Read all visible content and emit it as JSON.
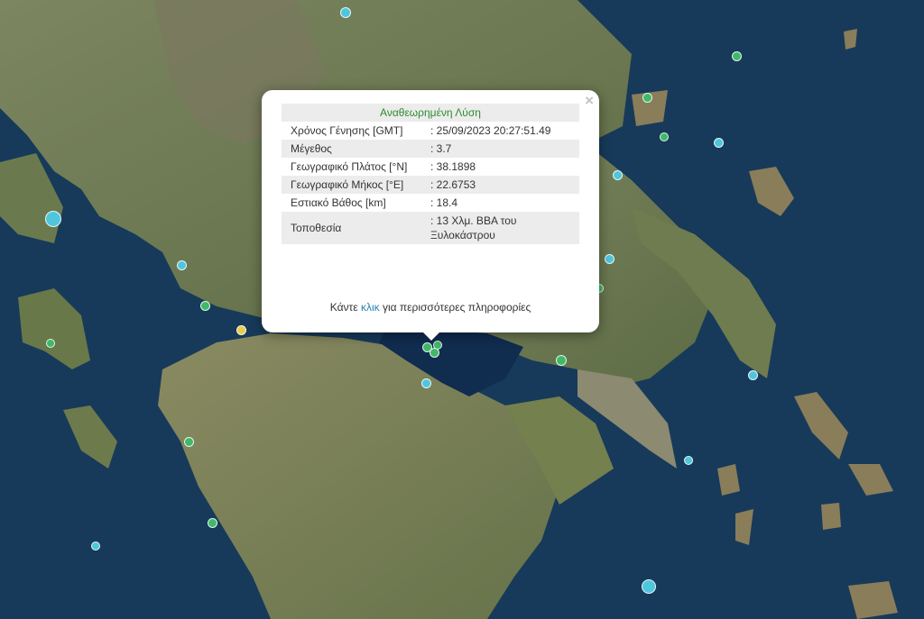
{
  "popup": {
    "header": "Αναθεωρημένη Λύση",
    "rows": [
      {
        "label": "Χρόνος Γένησης [GMT]",
        "value": ": 25/09/2023 20:27:51.49"
      },
      {
        "label": "Μέγεθος",
        "value": ": 3.7"
      },
      {
        "label": "Γεωγραφικό Πλάτος [°N]",
        "value": ": 38.1898"
      },
      {
        "label": "Γεωγραφικό Μήκος [°E]",
        "value": ": 22.6753"
      },
      {
        "label": "Εστιακό Βάθος [km]",
        "value": ": 18.4"
      },
      {
        "label": "Τοποθεσία",
        "value": ": 13 Χλμ. ΒΒΑ του Ξυλοκάστρου"
      }
    ],
    "more_prefix": "Κάντε ",
    "more_link": "κλικ",
    "more_suffix": " για περισσότερες πληροφορίες",
    "close": "×"
  },
  "colors": {
    "sea": "#173a5a",
    "land": "#6b7a4e",
    "marker_cyan": "#4fc6dc",
    "marker_green": "#3fb86a",
    "marker_yellow": "#e6cf4a"
  }
}
